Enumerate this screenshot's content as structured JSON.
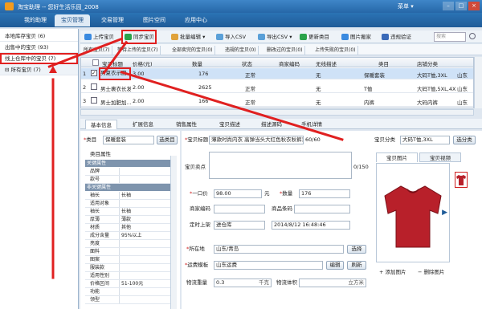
{
  "titlebar": {
    "title": "淘宝助理 -- 您好生活乐园_2008",
    "menu": "菜单 ▾"
  },
  "nav": {
    "tabs": [
      "我的助理",
      "宝贝管理",
      "交易管理",
      "图片空间",
      "应用中心"
    ]
  },
  "sidebar": {
    "items": [
      {
        "label": "本地库存宝贝 (6)"
      },
      {
        "label": "出售中的宝贝 (93)"
      },
      {
        "label": "线上仓库中的宝贝 (7)"
      },
      {
        "label": "所有宝贝 (7)"
      }
    ]
  },
  "toolbar": {
    "buttons": [
      "上传宝贝",
      "同步宝贝",
      "批量编辑",
      "导入CSV",
      "导出CSV",
      "更新类目",
      "图片搬家",
      "违规验证"
    ],
    "search_placeholder": "搜索"
  },
  "filtertabs": [
    "所有宝贝(7)",
    "等待上传的宝贝(7)",
    "全部卖完的宝贝(0)",
    "违规的宝贝(0)",
    "删改过的宝贝(0)",
    "上传失败的宝贝(0)"
  ],
  "grid": {
    "columns": [
      "",
      "宝贝标题",
      "价格(元)",
      "数量",
      "状态",
      "商家编码",
      "无线描述",
      "类目",
      "店铺分类",
      ""
    ],
    "rows": [
      {
        "idx": "1",
        "title": "男夏衣示圆...",
        "price": "3.00",
        "qty": "176",
        "status": "正常",
        "code": "",
        "wireless": "无",
        "category": "保暖套装",
        "shopcat": "大码T恤,3XL",
        "extra": "山东"
      },
      {
        "idx": "2",
        "title": "男士裹衣长发...",
        "price": "2.00",
        "qty": "2625",
        "status": "正常",
        "code": "",
        "wireless": "无",
        "category": "T恤",
        "shopcat": "大码T恤,5XL,4XL",
        "extra": "山东"
      },
      {
        "idx": "3",
        "title": "男士加肥加...",
        "price": "2.00",
        "qty": "166",
        "status": "正常",
        "code": "",
        "wireless": "无",
        "category": "内裤",
        "shopcat": "大码内裤",
        "extra": "山东"
      }
    ]
  },
  "edittabs": [
    "基本信息",
    "扩展信息",
    "销售属性",
    "宝贝描述",
    "描述源码",
    "手机详情"
  ],
  "form": {
    "category_label": "类目",
    "category_value": "保暖套装",
    "choose_category": "选类目",
    "attr_section": "类目属性",
    "key_attrs": "关键属性",
    "title_label": "宝贝标题",
    "title_value": "薄款时尚内衣 高弹当头大红色秋衣秋裤套装两套包邮",
    "title_count": "60/60",
    "shopcat_label": "宝贝分类",
    "shopcat_value": "大码T恤,3XL",
    "choose_shopcat": "选分类",
    "selling_label": "宝贝卖点",
    "selling_count": "0/150",
    "price_label": "一口价",
    "price_value": "98.00",
    "price_unit": "元",
    "qty_label": "数量",
    "qty_value": "176",
    "merchant_code_label": "商家编码",
    "barcode_label": "商品条码",
    "schedule_label": "定时上架",
    "schedule_value": "进仓库",
    "schedule_time": "2014/8/12  16:48:46",
    "location_label": "所在地",
    "location_value": "山东/青岛",
    "choose": "选择",
    "shipping_label": "运费模板",
    "shipping_value": "山东运费",
    "edit": "编辑",
    "refresh": "刷新",
    "weight_label": "物流重量",
    "weight_value": "0.3",
    "weight_unit": "千克",
    "volume_label": "物流体积",
    "volume_unit": "立方米"
  },
  "attrs": [
    {
      "k": "品牌",
      "v": ""
    },
    {
      "k": "款号",
      "v": ""
    }
  ],
  "nonkey_head": "非关键属性",
  "attrs2": [
    {
      "k": "袖长",
      "v": "长袖"
    },
    {
      "k": "适用对象",
      "v": ""
    },
    {
      "k": "袖长",
      "v": "长袖"
    },
    {
      "k": "厚薄",
      "v": "薄款"
    },
    {
      "k": "材质",
      "v": "其他"
    },
    {
      "k": "成分含量",
      "v": "95%以上"
    },
    {
      "k": "亮度",
      "v": ""
    },
    {
      "k": "面料",
      "v": ""
    },
    {
      "k": "图案",
      "v": ""
    },
    {
      "k": "服装款",
      "v": ""
    },
    {
      "k": "适用性别",
      "v": ""
    },
    {
      "k": "价格区间",
      "v": "51-100元"
    },
    {
      "k": "功能",
      "v": ""
    },
    {
      "k": "领型",
      "v": ""
    }
  ],
  "images": {
    "tab_pictures": "宝贝图片",
    "tab_video": "宝贝视频",
    "add": "添加图片",
    "delete": "删除图片"
  },
  "colors": {
    "accent": "#2667a8",
    "highlight": "#e02020",
    "selected_row": "#cfe2f7"
  }
}
